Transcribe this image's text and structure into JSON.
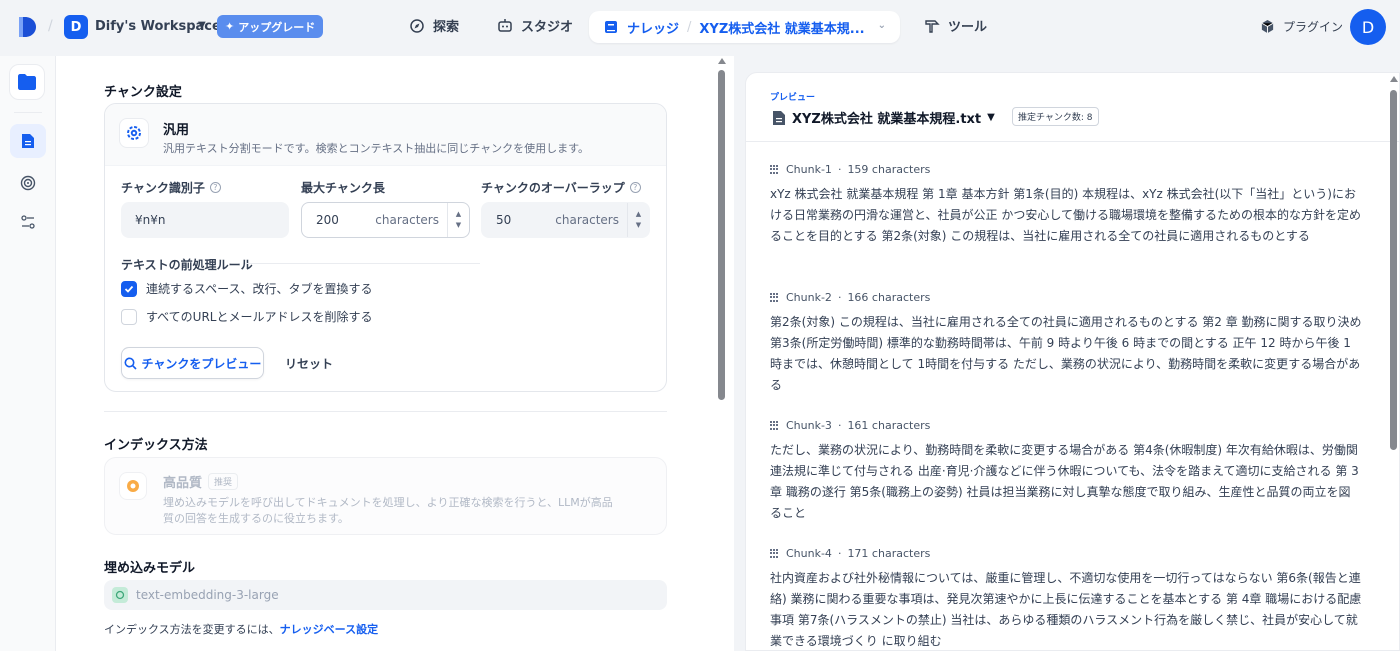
{
  "topbar": {
    "workspace_initial": "D",
    "workspace_name": "Dify's Workspace",
    "upgrade_label": "アップグレード",
    "nav": {
      "explore": "探索",
      "studio": "スタジオ",
      "knowledge": "ナレッジ",
      "dataset_name": "XYZ株式会社 就業基本規...",
      "tools": "ツール"
    },
    "plugin_label": "プラグイン",
    "avatar_initial": "D"
  },
  "settings": {
    "chunk_section_title": "チャンク設定",
    "general": {
      "title": "汎用",
      "description": "汎用テキスト分割モードです。検索とコンテキスト抽出に同じチャンクを使用します。"
    },
    "delimiter": {
      "label": "チャンク識別子",
      "value": "¥n¥n"
    },
    "max_length": {
      "label": "最大チャンク長",
      "value": "200",
      "unit": "characters"
    },
    "overlap": {
      "label": "チャンクのオーバーラップ",
      "value": "50",
      "unit": "characters"
    },
    "preprocess": {
      "label": "テキストの前処理ルール",
      "rules": [
        {
          "label": "連続するスペース、改行、タブを置換する",
          "checked": true
        },
        {
          "label": "すべてのURLとメールアドレスを削除する",
          "checked": false
        }
      ]
    },
    "preview_button": "チャンクをプレビュー",
    "reset_button": "リセット",
    "index_section_title": "インデックス方法",
    "index": {
      "title": "高品質",
      "badge": "推奨",
      "description": "埋め込みモデルを呼び出してドキュメントを処理し、より正確な検索を行うと、LLMが高品質の回答を生成するのに役立ちます。"
    },
    "embedding_section_title": "埋め込みモデル",
    "embedding_model": "text-embedding-3-large",
    "note_prefix": "インデックス方法を変更するには、",
    "note_link": "ナレッジベース設定"
  },
  "preview": {
    "eyebrow": "プレビュー",
    "file_name": "XYZ株式会社 就業基本規程.txt",
    "estimate_badge": "推定チャンク数: 8",
    "chunks": [
      {
        "name": "Chunk-1",
        "chars": "159 characters",
        "text": "xYz 株式会社 就業基本規程 第 1章 基本方針 第1条(目的) 本規程は、xYz 株式会社(以下「当社」という)における日常業務の円滑な運営と、社員が公正 かつ安心して働ける職場環境を整備するための根本的な方針を定めることを目的とする 第2条(対象) この規程は、当社に雇用される全ての社員に適用されるものとする"
      },
      {
        "name": "Chunk-2",
        "chars": "166 characters",
        "text": "第2条(対象) この規程は、当社に雇用される全ての社員に適用されるものとする 第2 章 勤務に関する取り決め 第3条(所定労働時間) 標準的な勤務時間帯は、午前 9 時より午後 6 時までの間とする 正午 12 時から午後 1 時までは、休憩時間として 1時間を付与する ただし、業務の状況により、勤務時間を柔軟に変更する場合がある"
      },
      {
        "name": "Chunk-3",
        "chars": "161 characters",
        "text": "ただし、業務の状況により、勤務時間を柔軟に変更する場合がある 第4条(休暇制度) 年次有給休暇は、労働関連法規に準じて付与される 出産·育児·介護などに伴う休暇についても、法令を踏まえて適切に支給される 第 3 章 職務の遂行 第5条(職務上の姿勢) 社員は担当業務に対し真摯な態度で取り組み、生産性と品質の両立を図ること"
      },
      {
        "name": "Chunk-4",
        "chars": "171 characters",
        "text": "社内資産および社外秘情報については、厳重に管理し、不適切な使用を一切行ってはならない 第6条(報告と連絡) 業務に関わる重要な事項は、発見次第速やかに上長に伝達することを基本とする 第 4章 職場における配慮事項 第7条(ハラスメントの禁止) 当社は、あらゆる種類のハラスメント行為を厳しく禁じ、社員が安心して就業できる環境づくり に取り組む"
      }
    ]
  },
  "colors": {
    "accent": "#155eef",
    "upgrade": "#5a8dee"
  }
}
